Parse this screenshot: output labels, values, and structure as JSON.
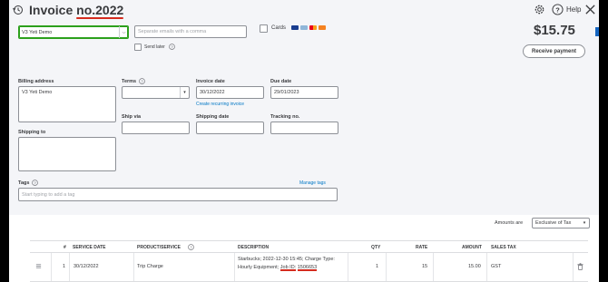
{
  "header": {
    "title_prefix": "Invoice ",
    "title_number": "no.2022",
    "help_label": "Help"
  },
  "customer": {
    "value": "V3 Yeti Demo"
  },
  "email": {
    "placeholder": "Separate emails with a comma",
    "send_later_label": "Send later"
  },
  "payment": {
    "cards_label": "Cards"
  },
  "balance": {
    "amount": "$15.75",
    "receive_payment_label": "Receive payment"
  },
  "billing": {
    "label": "Billing address",
    "value": "V3 Yeti Demo"
  },
  "terms": {
    "label": "Terms"
  },
  "invoice_date": {
    "label": "Invoice date",
    "value": "30/12/2022",
    "create_recurring_label": "Create recurring invoice"
  },
  "due_date": {
    "label": "Due date",
    "value": "29/01/2023"
  },
  "ship_via": {
    "label": "Ship via"
  },
  "shipping_date": {
    "label": "Shipping date"
  },
  "tracking": {
    "label": "Tracking no."
  },
  "shipping_to": {
    "label": "Shipping to"
  },
  "tags": {
    "label": "Tags",
    "manage_label": "Manage tags",
    "placeholder": "Start typing to add a tag"
  },
  "amounts_are": {
    "label": "Amounts are",
    "value": "Exclusive of Tax"
  },
  "table": {
    "headers": {
      "num": "#",
      "service_date": "SERVICE DATE",
      "product": "PRODUCT/SERVICE",
      "description": "DESCRIPTION",
      "qty": "QTY",
      "rate": "RATE",
      "amount": "AMOUNT",
      "sales_tax": "SALES TAX"
    },
    "rows": [
      {
        "num": "1",
        "service_date": "30/12/2022",
        "product": "Trip Charge",
        "description_part1": "Starbucks; 2022-12-30 15:45; Charge Type: Hourly Equipment; ",
        "description_job": "Job ID:",
        "description_id": "1506653",
        "qty": "1",
        "rate": "15",
        "amount": "15.00",
        "sales_tax": "GST"
      }
    ]
  },
  "colors": {
    "accent_green": "#2ca01c",
    "annotation_red": "#d52b1e",
    "link_blue": "#0077c5"
  }
}
